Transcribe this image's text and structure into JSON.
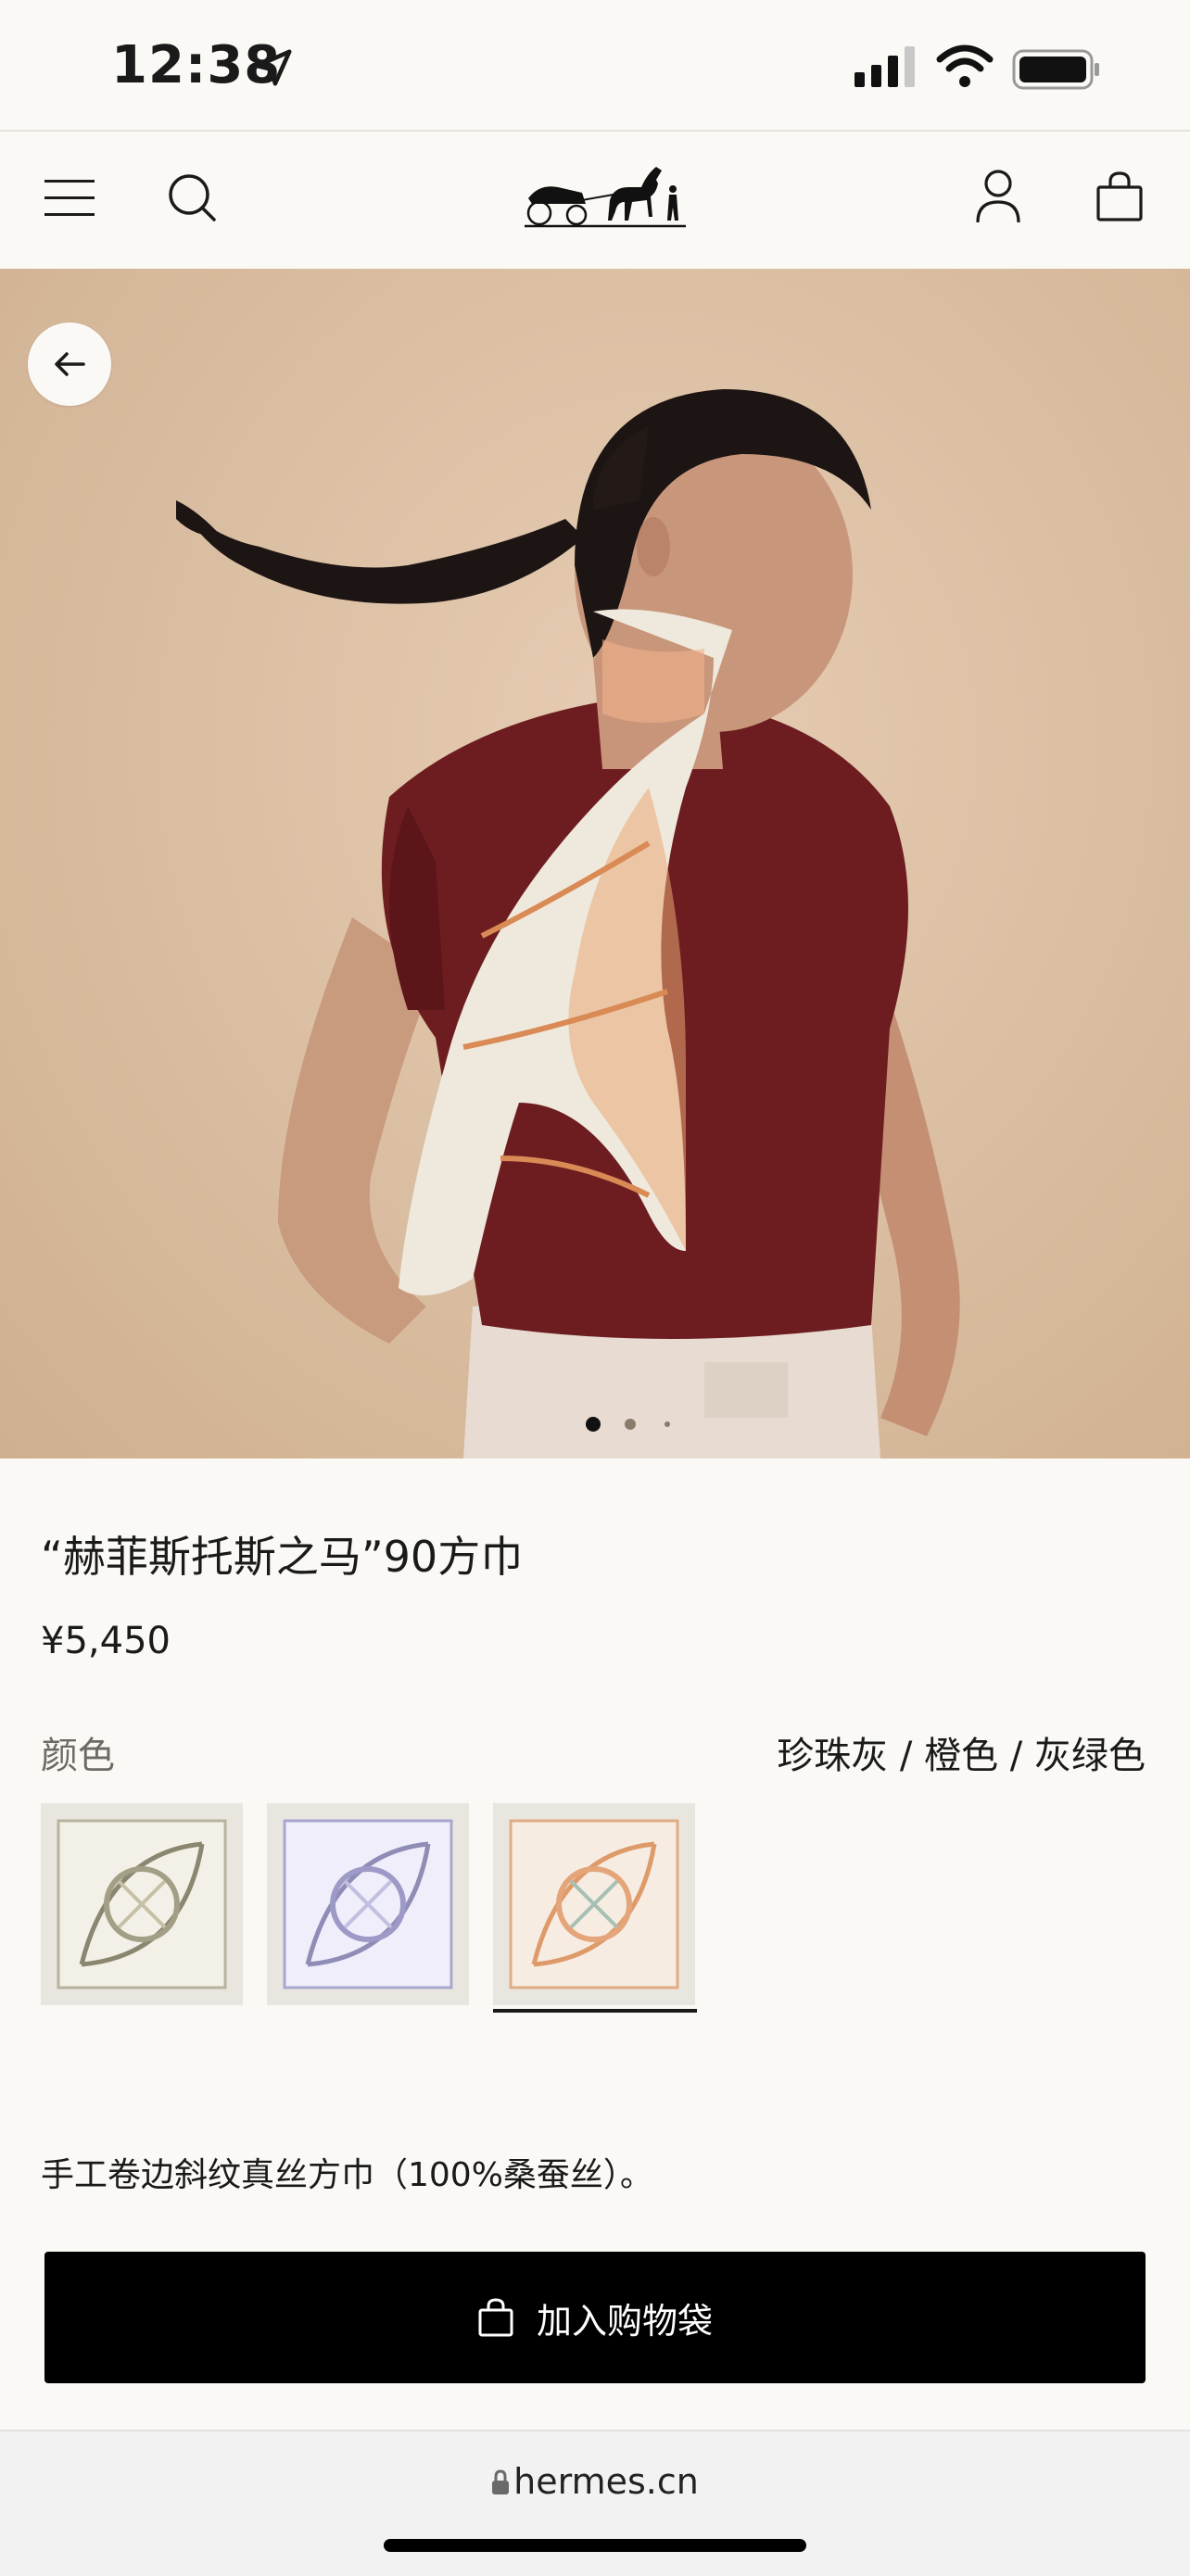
{
  "status_bar": {
    "time": "12:38"
  },
  "header": {
    "logo_alt": "Hermès"
  },
  "product": {
    "title": "“赫菲斯托斯之马”90方巾",
    "price": "¥5,450",
    "color_label": "颜色",
    "color_value": "珍珠灰 / 橙色 / 灰绿色",
    "swatches": [
      {
        "name": "gray",
        "accent": "#8a8670",
        "selected": false
      },
      {
        "name": "lavender",
        "accent": "#8f8cb6",
        "selected": false
      },
      {
        "name": "orange",
        "accent": "#df9a6a",
        "selected": true
      }
    ],
    "description": "手工卷边斜纹真丝方巾（100%桑蚕丝）。",
    "add_to_bag": "加入购物袋"
  },
  "carousel": {
    "current": 1,
    "total": 3
  },
  "browser": {
    "url": "hermes.cn"
  }
}
